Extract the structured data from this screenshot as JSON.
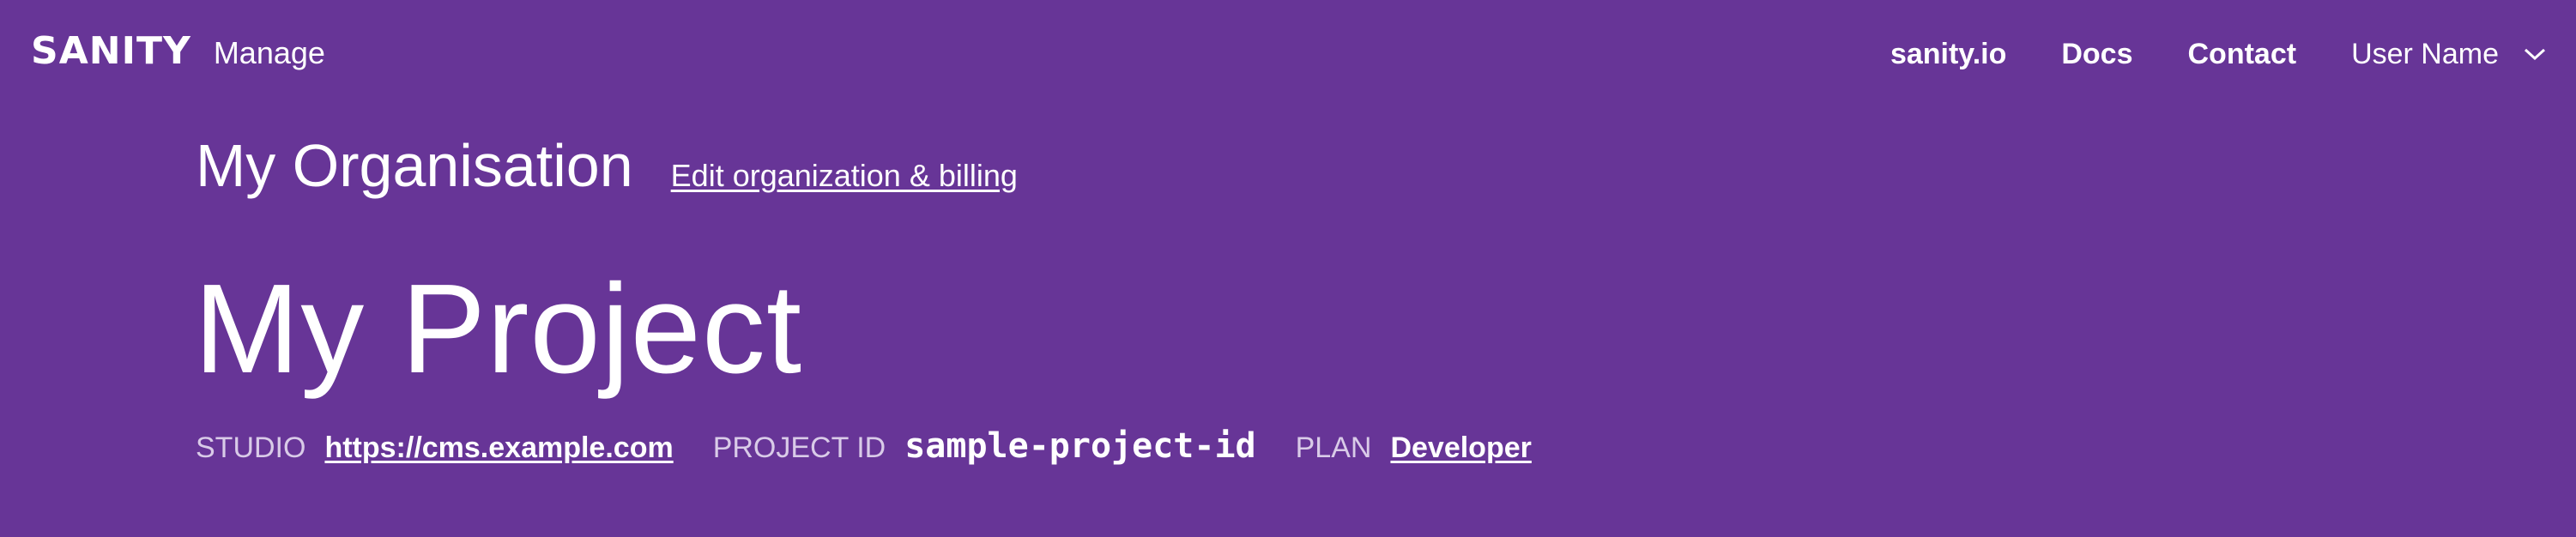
{
  "header": {
    "logo": "SANITY",
    "section": "Manage",
    "nav": [
      {
        "label": "sanity.io"
      },
      {
        "label": "Docs"
      },
      {
        "label": "Contact"
      }
    ],
    "user_name": "User Name",
    "user_menu_icon": "chevron-down-icon"
  },
  "organization": {
    "name": "My Organisation",
    "edit_link": "Edit organization & billing"
  },
  "project": {
    "name": "My Project",
    "studio_label": "STUDIO",
    "studio_url": "https://cms.example.com",
    "project_id_label": "PROJECT ID",
    "project_id": "sample-project-id",
    "plan_label": "PLAN",
    "plan": "Developer"
  },
  "colors": {
    "background": "#673597",
    "text": "#ffffff",
    "muted_label": "#d9cbe8"
  }
}
